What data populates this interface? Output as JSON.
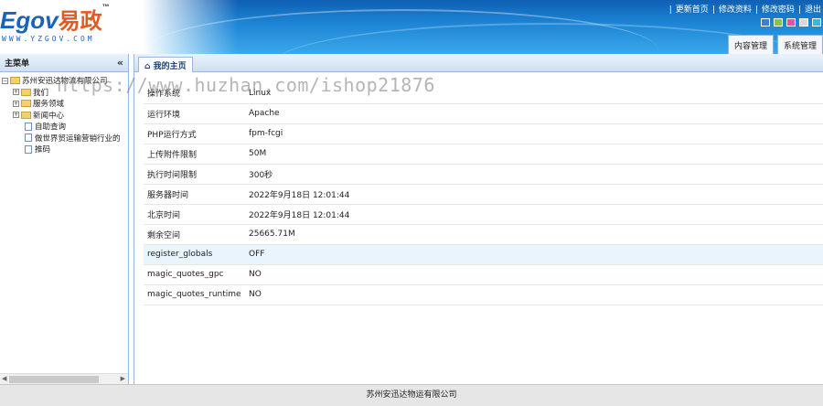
{
  "header": {
    "logo_text": "Egov",
    "logo_cn": "易政",
    "logo_tm": "™",
    "logo_url": "WWW.YZGOV.COM",
    "toplinks": [
      "更新首页",
      "修改资料",
      "修改密码",
      "退出"
    ],
    "swatch_colors": [
      "#3a7fd5",
      "#8ac43f",
      "#e44fb6",
      "#d8d8d8",
      "#3ab5e8"
    ],
    "tabs": [
      "内容管理",
      "系统管理"
    ]
  },
  "sidebar": {
    "title": "主菜单",
    "collapse_icon": "«",
    "tree": [
      {
        "label": "苏州安迅达物流有限公司",
        "type": "root"
      },
      {
        "label": "我们",
        "type": "folder"
      },
      {
        "label": "服务领域",
        "type": "folder"
      },
      {
        "label": "新闻中心",
        "type": "folder"
      },
      {
        "label": "自助查询",
        "type": "page"
      },
      {
        "label": "做世界贸运输营销行业的",
        "type": "page"
      },
      {
        "label": "推码",
        "type": "page"
      }
    ]
  },
  "main": {
    "tab_label": "我的主页",
    "rows": [
      {
        "key": "操作系统",
        "value": "Linux"
      },
      {
        "key": "运行环境",
        "value": "Apache"
      },
      {
        "key": "PHP运行方式",
        "value": "fpm-fcgi"
      },
      {
        "key": "上传附件限制",
        "value": "50M"
      },
      {
        "key": "执行时间限制",
        "value": "300秒"
      },
      {
        "key": "服务器时间",
        "value": "2022年9月18日 12:01:44"
      },
      {
        "key": "北京时间",
        "value": "2022年9月18日 12:01:44"
      },
      {
        "key": "剩余空间",
        "value": "25665.71M"
      },
      {
        "key": "register_globals",
        "value": "OFF"
      },
      {
        "key": "magic_quotes_gpc",
        "value": "NO"
      },
      {
        "key": "magic_quotes_runtime",
        "value": "NO"
      }
    ]
  },
  "footer": {
    "text": "苏州安迅达物运有限公司"
  },
  "watermark": "https://www.huzhan.com/ishop21876"
}
